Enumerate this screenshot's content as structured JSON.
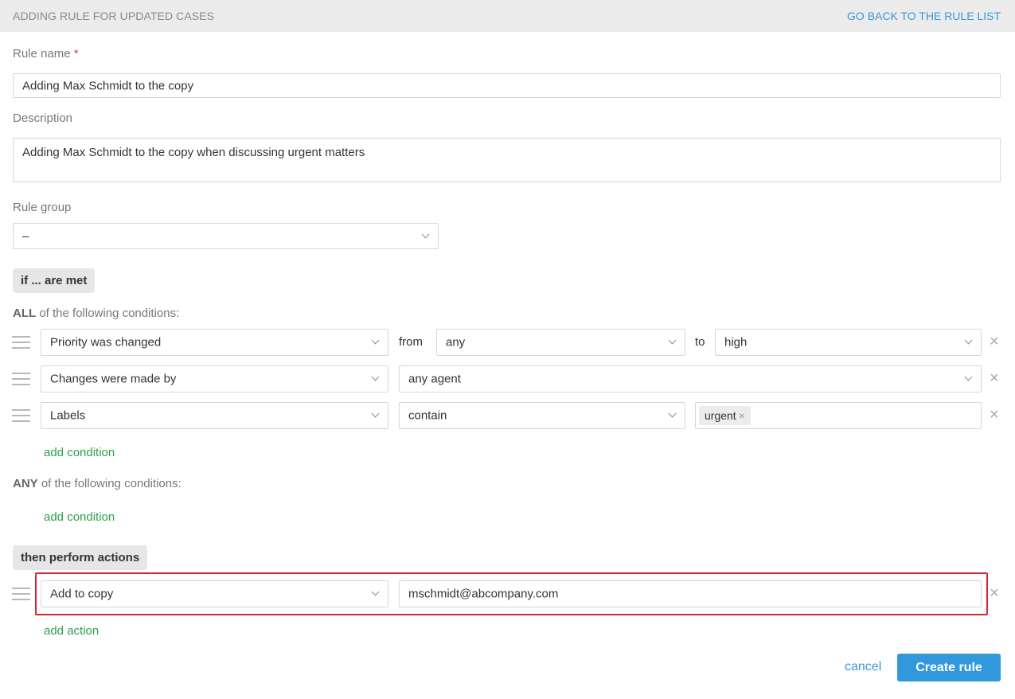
{
  "header": {
    "title": "ADDING RULE FOR UPDATED CASES",
    "back_link": "GO BACK TO THE RULE LIST"
  },
  "form": {
    "rule_name_label": "Rule name",
    "required_mark": "*",
    "rule_name_value": "Adding Max Schmidt to the copy",
    "description_label": "Description",
    "description_value": "Adding Max Schmidt to the copy when discussing urgent matters",
    "rule_group_label": "Rule group",
    "rule_group_value": "–"
  },
  "conditions": {
    "section_label": "if ... are met",
    "all_keyword": "ALL",
    "all_suffix": " of the following conditions:",
    "any_keyword": "ANY",
    "any_suffix": " of the following conditions:",
    "add_condition": "add condition",
    "rows": [
      {
        "field": "Priority was changed",
        "from_word": "from",
        "from_value": "any",
        "to_word": "to",
        "to_value": "high"
      },
      {
        "field": "Changes were made by",
        "value": "any agent"
      },
      {
        "field": "Labels",
        "operator": "contain",
        "tag": "urgent"
      }
    ]
  },
  "actions": {
    "section_label": "then perform actions",
    "rows": [
      {
        "action": "Add to copy",
        "value": "mschmidt@abcompany.com"
      }
    ],
    "add_action": "add action"
  },
  "footer": {
    "cancel": "cancel",
    "create": "Create rule"
  },
  "icons": {
    "remove": "×",
    "tag_remove": "×"
  },
  "colors": {
    "accent_blue": "#3198dc",
    "link_green": "#2ba24c",
    "highlight_red": "#d9262e"
  }
}
